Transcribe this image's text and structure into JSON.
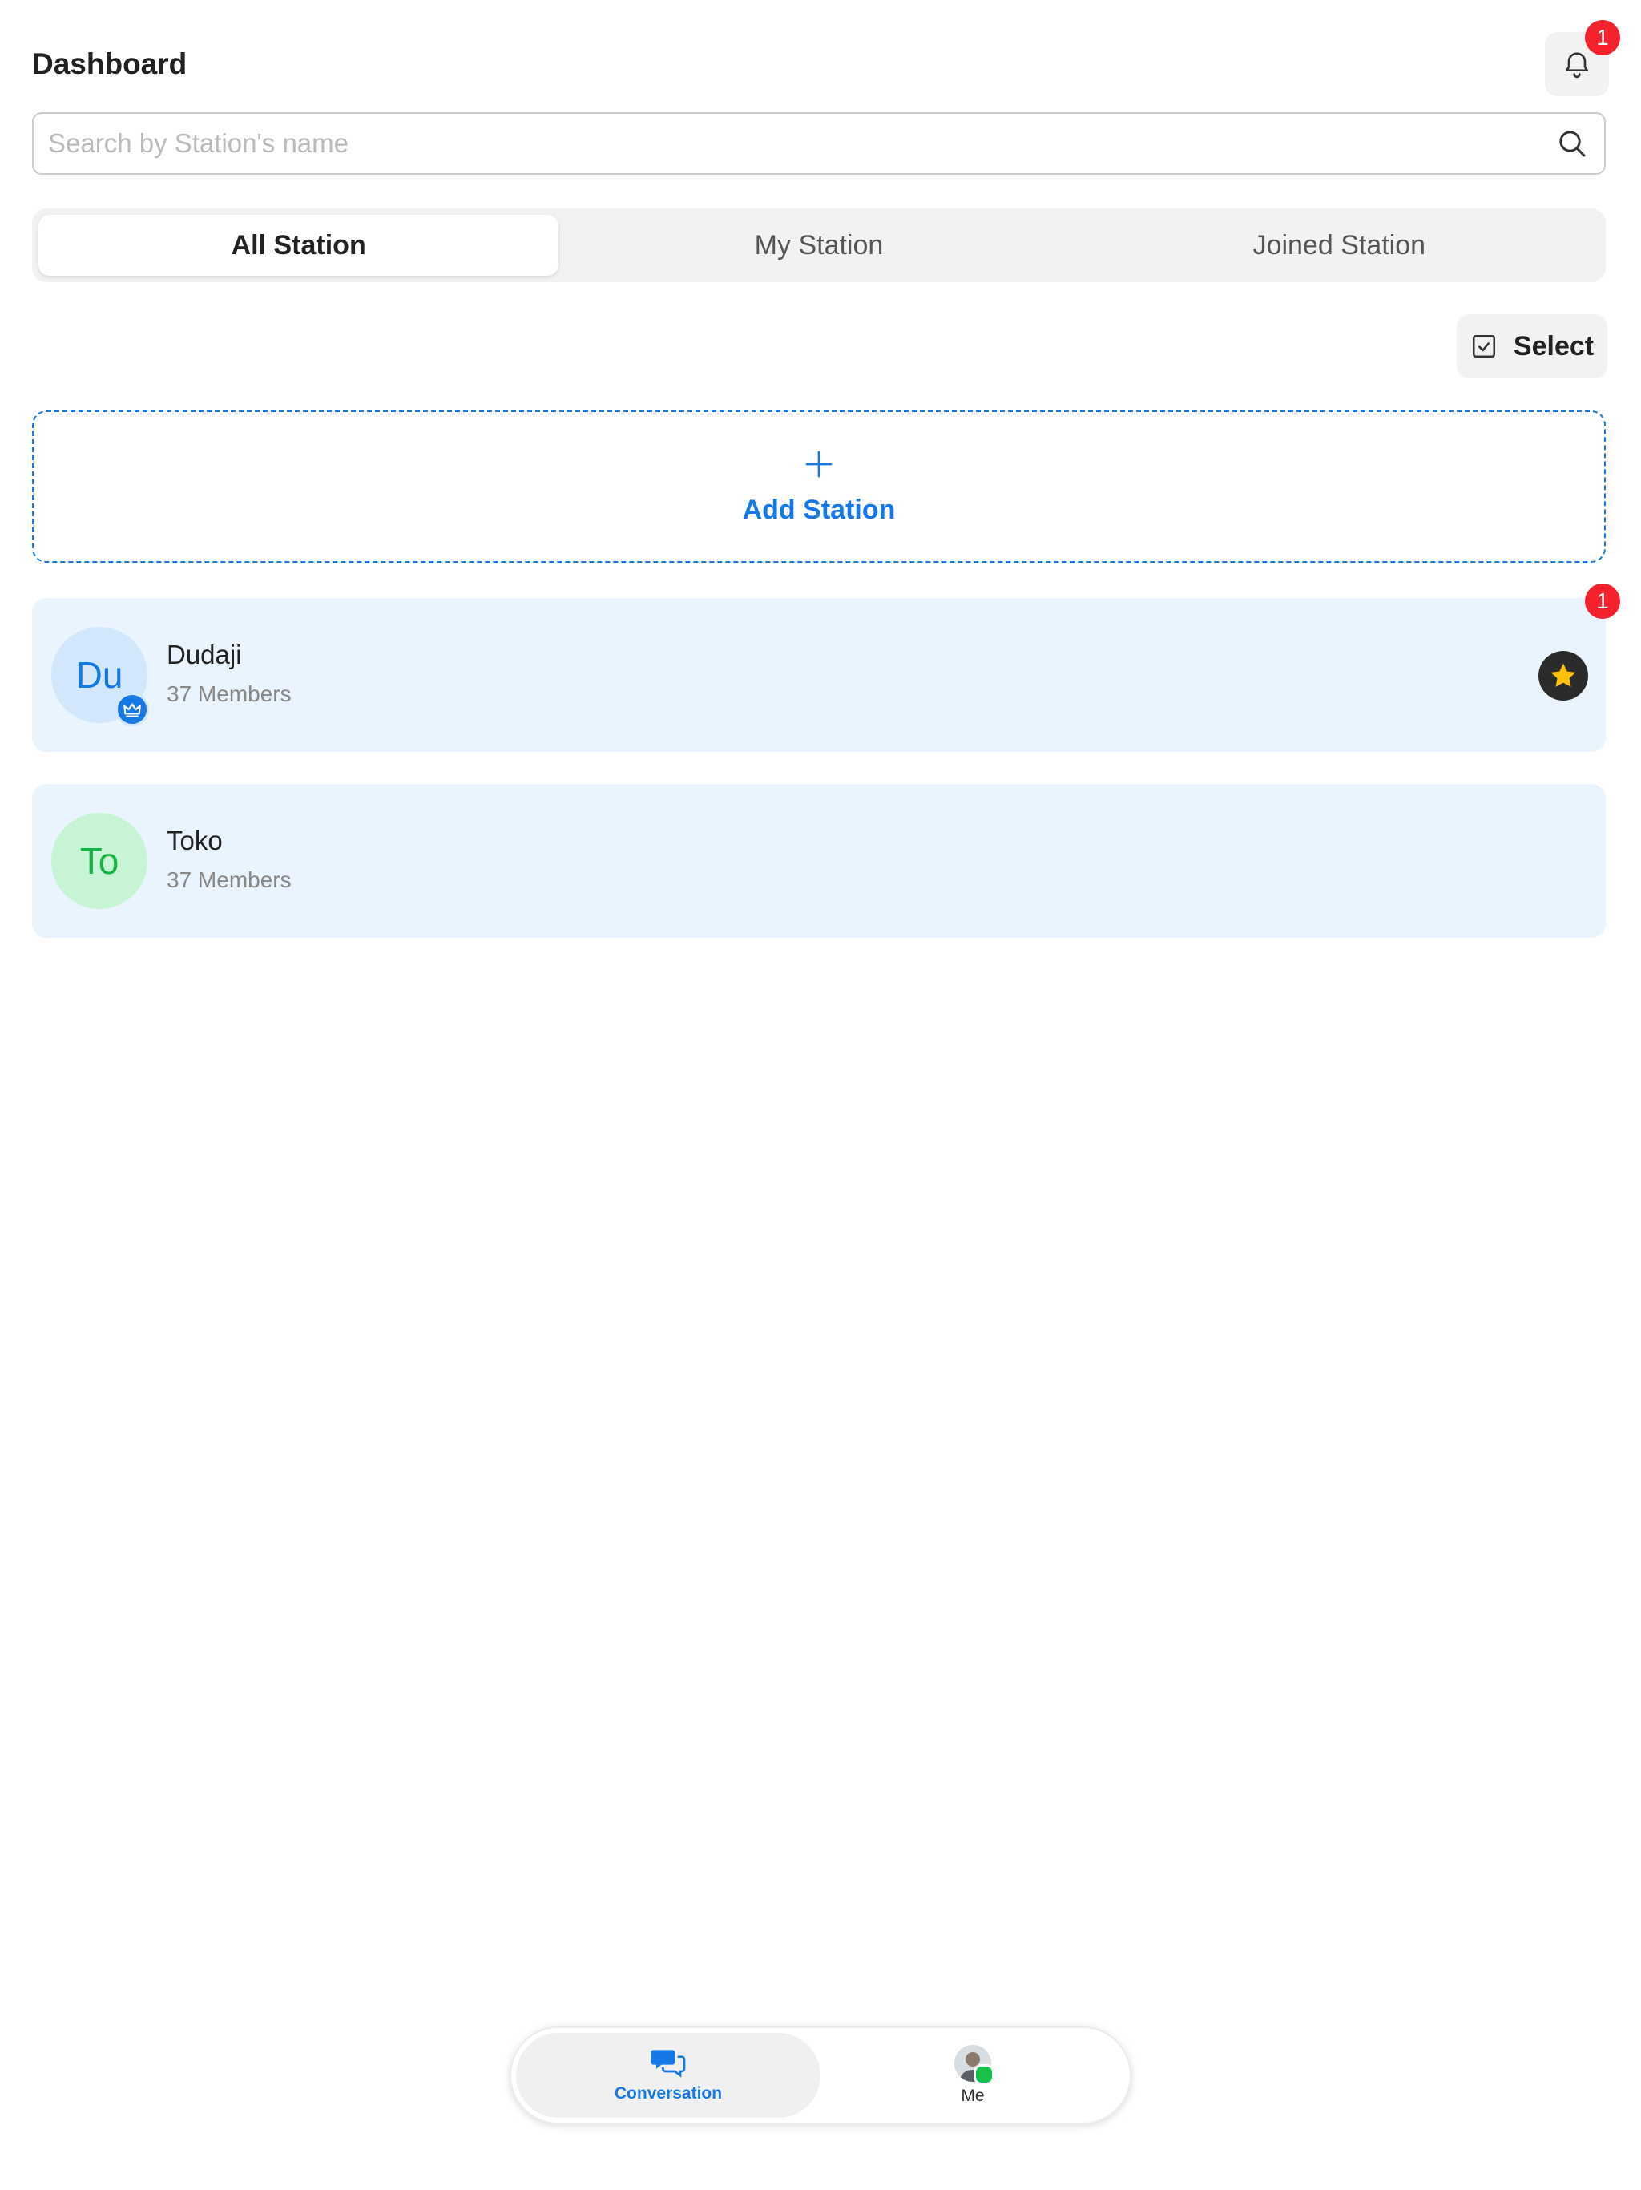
{
  "header": {
    "title": "Dashboard",
    "notification_count": "1"
  },
  "search": {
    "placeholder": "Search by Station's name",
    "value": ""
  },
  "tabs": [
    {
      "label": "All Station",
      "active": true
    },
    {
      "label": "My Station",
      "active": false
    },
    {
      "label": "Joined Station",
      "active": false
    }
  ],
  "toolbar": {
    "select_label": "Select"
  },
  "add_station": {
    "label": "Add Station"
  },
  "stations": [
    {
      "initials": "Du",
      "name": "Dudaji",
      "members": "37 Members",
      "badge": "1",
      "owner_icon": "crown-icon",
      "favorite_icon": "star-icon"
    },
    {
      "initials": "To",
      "name": "Toko",
      "members": "37 Members"
    }
  ],
  "bottom_nav": {
    "items": [
      {
        "label": "Conversation",
        "icon": "chat-bubbles-icon",
        "active": true
      },
      {
        "label": "Me",
        "icon": "avatar",
        "active": false
      }
    ]
  },
  "colors": {
    "accent": "#1677e6",
    "badge": "#f5222d",
    "card_bg": "#eaf4fe",
    "online": "#16c24a",
    "star": "#ffc107"
  }
}
